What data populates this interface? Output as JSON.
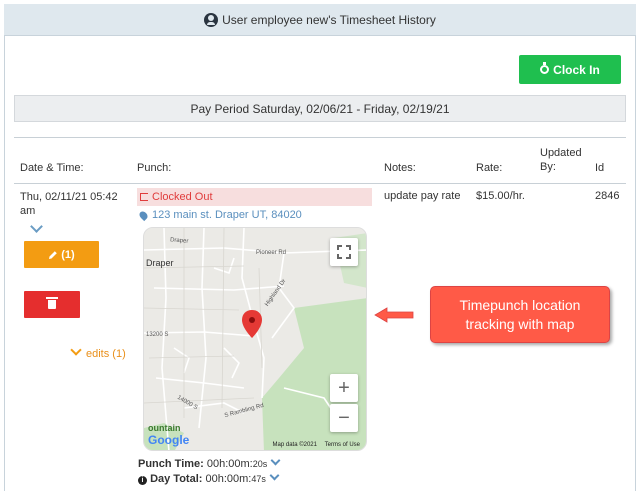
{
  "header": {
    "title": "User employee new's Timesheet History",
    "icon": "user-circle-icon"
  },
  "clock_in_button": {
    "label": "Clock In",
    "icon": "stopwatch-icon",
    "color": "#1fbf4f"
  },
  "pay_period": "Pay Period Saturday, 02/06/21 - Friday, 02/19/21",
  "table": {
    "headers": {
      "date_time": "Date & Time:",
      "punch": "Punch:",
      "notes": "Notes:",
      "rate": "Rate:",
      "updated_by": [
        "Updated",
        "By:"
      ],
      "id": "Id"
    },
    "row": {
      "date_line1": "Thu, 02/11/21 05:42",
      "date_line2": "am",
      "edit_button": "(1)",
      "edits_link": "edits (1)",
      "punch_status": "Clocked Out",
      "address": "123 main st. Draper UT, 84020",
      "notes": "update pay rate",
      "rate": "$15.00/hr.",
      "id": "2846",
      "punch_time_label": "Punch Time:",
      "punch_time_value": "00h:00m:",
      "punch_time_sec": "20s",
      "day_total_label": "Day Total:",
      "day_total_value": "00h:00m:",
      "day_total_sec": "47s"
    }
  },
  "map": {
    "labels": {
      "draper": "Draper",
      "pioneer": "Pioneer Rd",
      "s13200": "13200 S",
      "s14000": "14000 S",
      "highland": "Highland Dr",
      "sramblingrd": "S Rambling Rd"
    },
    "zoom_in": "+",
    "zoom_out": "−",
    "attribution": "Map data ©2021",
    "terms": "Terms of Use",
    "google": "Google",
    "mountain": "ountain"
  },
  "callout": {
    "line1": "Timepunch location",
    "line2": "tracking with map"
  },
  "colors": {
    "edit": "#f39c12",
    "delete": "#e52e2e",
    "callout": "#ff5a47",
    "link": "#5a8fbe"
  }
}
